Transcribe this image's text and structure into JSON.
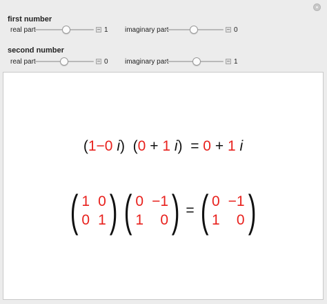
{
  "first": {
    "title": "first number",
    "real_label": "real part",
    "real_value": "1",
    "imag_label": "imaginary part",
    "imag_value": "0"
  },
  "second": {
    "title": "second number",
    "real_label": "real part",
    "real_value": "0",
    "imag_label": "imaginary part",
    "imag_value": "1"
  },
  "expression": {
    "open1": "(",
    "a_re": "1",
    "a_op": "−",
    "a_im": "0",
    "i1": "i",
    "close1": ")",
    "open2": "(",
    "b_re": "0",
    "b_op": "+",
    "b_im": "1",
    "i2": "i",
    "close2": ")",
    "eq": "=",
    "r_re": "0",
    "r_op": "+",
    "r_im": "1",
    "i3": "i"
  },
  "matrices": {
    "m1": [
      "1",
      "0",
      "0",
      "1"
    ],
    "m2": [
      "0",
      "−1",
      "1",
      "0"
    ],
    "eq": "=",
    "result": [
      "0",
      "−1",
      "1",
      "0"
    ]
  },
  "colors": {
    "number_red": "#e8211d"
  }
}
